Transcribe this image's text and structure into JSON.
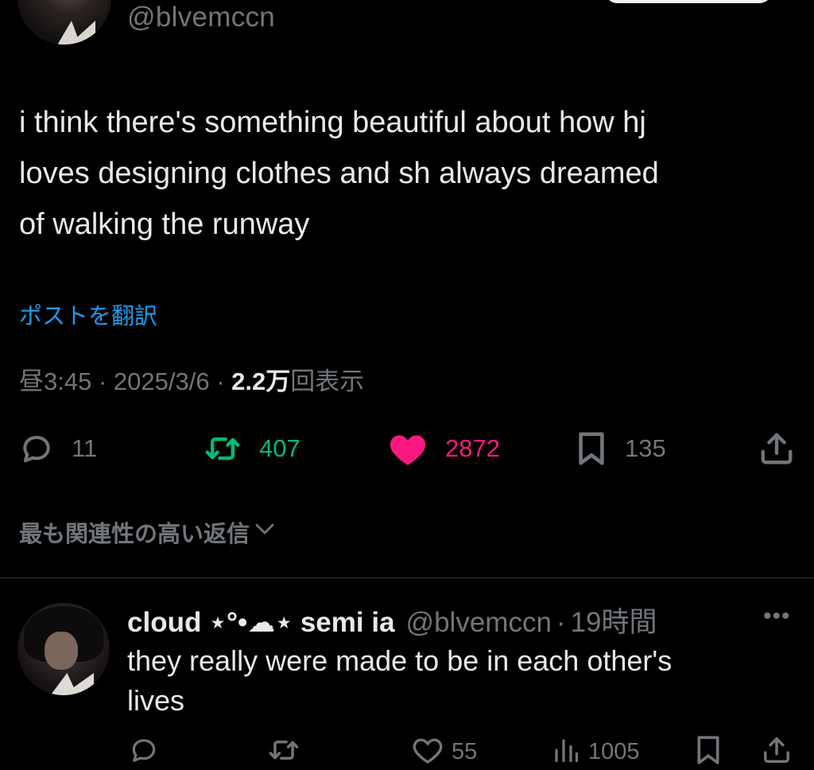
{
  "header": {
    "handle": "@blvemccn"
  },
  "tweet": {
    "text": "i think there's something beautiful about how hj\nloves designing clothes and sh always dreamed\nof walking the runway",
    "translate_label": "ポストを翻訳",
    "time": "昼3:45",
    "date": "2025/3/6",
    "views_count": "2.2万",
    "views_label": "回表示",
    "separator": "·",
    "stats": {
      "replies": "11",
      "reposts": "407",
      "likes": "2872",
      "bookmarks": "135"
    }
  },
  "replies_sort": {
    "label": "最も関連性の高い返信"
  },
  "reply": {
    "display_name": "cloud ⋆°•☁︎⋆ semi ia",
    "handle": "@blvemccn",
    "separator": "·",
    "time_ago": "19時間",
    "text": "they really were made to be in each other's\nlives",
    "stats": {
      "likes": "55",
      "views": "1005"
    }
  },
  "colors": {
    "background": "#000000",
    "text_primary": "#e7e9ea",
    "text_secondary": "#71767b",
    "link": "#1d9bf0",
    "repost": "#00ba7c",
    "like": "#f91880",
    "divider": "#2f3336"
  },
  "icons": {
    "reply": "comment-bubble-icon",
    "repost": "repost-arrows-icon",
    "like": "heart-icon",
    "bookmark": "bookmark-icon",
    "share": "share-upload-icon",
    "views": "bar-chart-icon",
    "more": "more-dots-icon",
    "sort": "chevron-down-icon"
  }
}
